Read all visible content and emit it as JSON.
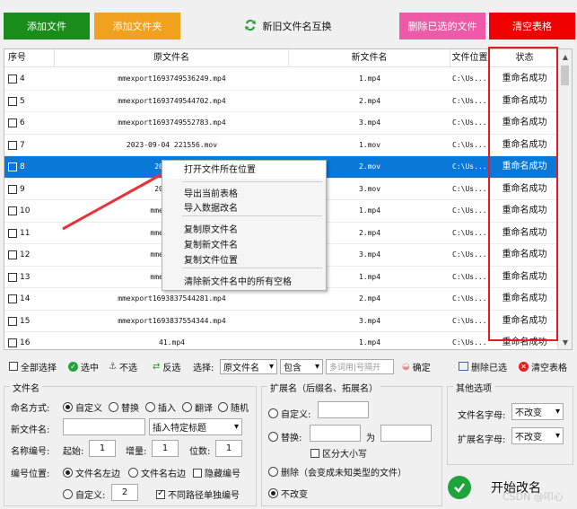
{
  "toolbar": {
    "add_file": "添加文件",
    "add_folder": "添加文件夹",
    "swap": "新旧文件名互换",
    "delete_selected": "删除已选的文件",
    "clear_table": "清空表格"
  },
  "table": {
    "headers": [
      "序号",
      "原文件名",
      "新文件名",
      "文件位置",
      "状态"
    ],
    "rows": [
      {
        "no": "4",
        "orig": "mmexport1693749536249.mp4",
        "new": "1.mp4",
        "loc": "C:\\Us...",
        "status": "重命名成功"
      },
      {
        "no": "5",
        "orig": "mmexport1693749544702.mp4",
        "new": "2.mp4",
        "loc": "C:\\Us...",
        "status": "重命名成功"
      },
      {
        "no": "6",
        "orig": "mmexport1693749552783.mp4",
        "new": "3.mp4",
        "loc": "C:\\Us...",
        "status": "重命名成功"
      },
      {
        "no": "7",
        "orig": "2023-09-04 221556.mov",
        "new": "1.mov",
        "loc": "C:\\Us...",
        "status": "重命名成功"
      },
      {
        "no": "8",
        "orig": "2023-09-",
        "new": "2.mov",
        "loc": "C:\\Us...",
        "status": "重命名成功"
      },
      {
        "no": "9",
        "orig": "2023-09-",
        "new": "3.mov",
        "loc": "C:\\Us...",
        "status": "重命名成功"
      },
      {
        "no": "10",
        "orig": "mmexport16",
        "new": "1.mp4",
        "loc": "C:\\Us...",
        "status": "重命名成功"
      },
      {
        "no": "11",
        "orig": "mmexport16",
        "new": "2.mp4",
        "loc": "C:\\Us...",
        "status": "重命名成功"
      },
      {
        "no": "12",
        "orig": "mmexport16",
        "new": "3.mp4",
        "loc": "C:\\Us...",
        "status": "重命名成功"
      },
      {
        "no": "13",
        "orig": "mmexport16",
        "new": "1.mp4",
        "loc": "C:\\Us...",
        "status": "重命名成功"
      },
      {
        "no": "14",
        "orig": "mmexport1693837544281.mp4",
        "new": "2.mp4",
        "loc": "C:\\Us...",
        "status": "重命名成功"
      },
      {
        "no": "15",
        "orig": "mmexport1693837554344.mp4",
        "new": "3.mp4",
        "loc": "C:\\Us...",
        "status": "重命名成功"
      },
      {
        "no": "16",
        "orig": "41.mp4",
        "new": "1.mp4",
        "loc": "C:\\Us...",
        "status": "重命名成功"
      }
    ]
  },
  "context_menu": {
    "items": [
      "打开文件所在位置",
      "导出当前表格",
      "导入数据改名",
      "复制原文件名",
      "复制新文件名",
      "复制文件位置",
      "清除新文件名中的所有空格"
    ]
  },
  "bar": {
    "select_all": "全部选择",
    "check": "选中",
    "uncheck": "不选",
    "invert": "反选",
    "select_label": "选择:",
    "field_value": "原文件名",
    "match_value": "包含",
    "search_placeholder": "多词用|号隔开",
    "confirm": "确定",
    "delete_checked": "删除已选",
    "clear_table": "清空表格"
  },
  "filename_group": {
    "title": "文件名",
    "mode_label": "命名方式:",
    "modes": [
      "自定义",
      "替换",
      "插入",
      "翻译",
      "随机"
    ],
    "new_name_label": "新文件名:",
    "new_name_value": "",
    "insert_tag": "插入特定标题",
    "numbering_label": "名称编号:",
    "start_label": "起始:",
    "start_value": "1",
    "step_label": "增量:",
    "step_value": "1",
    "digits_label": "位数:",
    "digits_value": "1",
    "pos_label": "编号位置:",
    "pos_left": "文件名左边",
    "pos_right": "文件名右边",
    "hide_number": "隐藏编号",
    "custom": "自定义:",
    "custom_value": "2",
    "separate_path": "不同路径单独编号"
  },
  "ext_group": {
    "title": "扩展名（后缀名、拓展名）",
    "custom": "自定义:",
    "replace": "替换:",
    "as_label": "为",
    "case_sensitive": "区分大小写",
    "delete": "删除（会变成未知类型的文件）",
    "unchanged": "不改变"
  },
  "other_group": {
    "title": "其他选项",
    "name_case_label": "文件名字母:",
    "name_case_value": "不改变",
    "ext_case_label": "扩展名字母:",
    "ext_case_value": "不改变"
  },
  "start_button": "开始改名",
  "watermark": "CSDN @叩心",
  "colors": {
    "selected_row": "#0a78d7",
    "highlight_outline": "#e41b23",
    "arrow": "#e8323a"
  }
}
